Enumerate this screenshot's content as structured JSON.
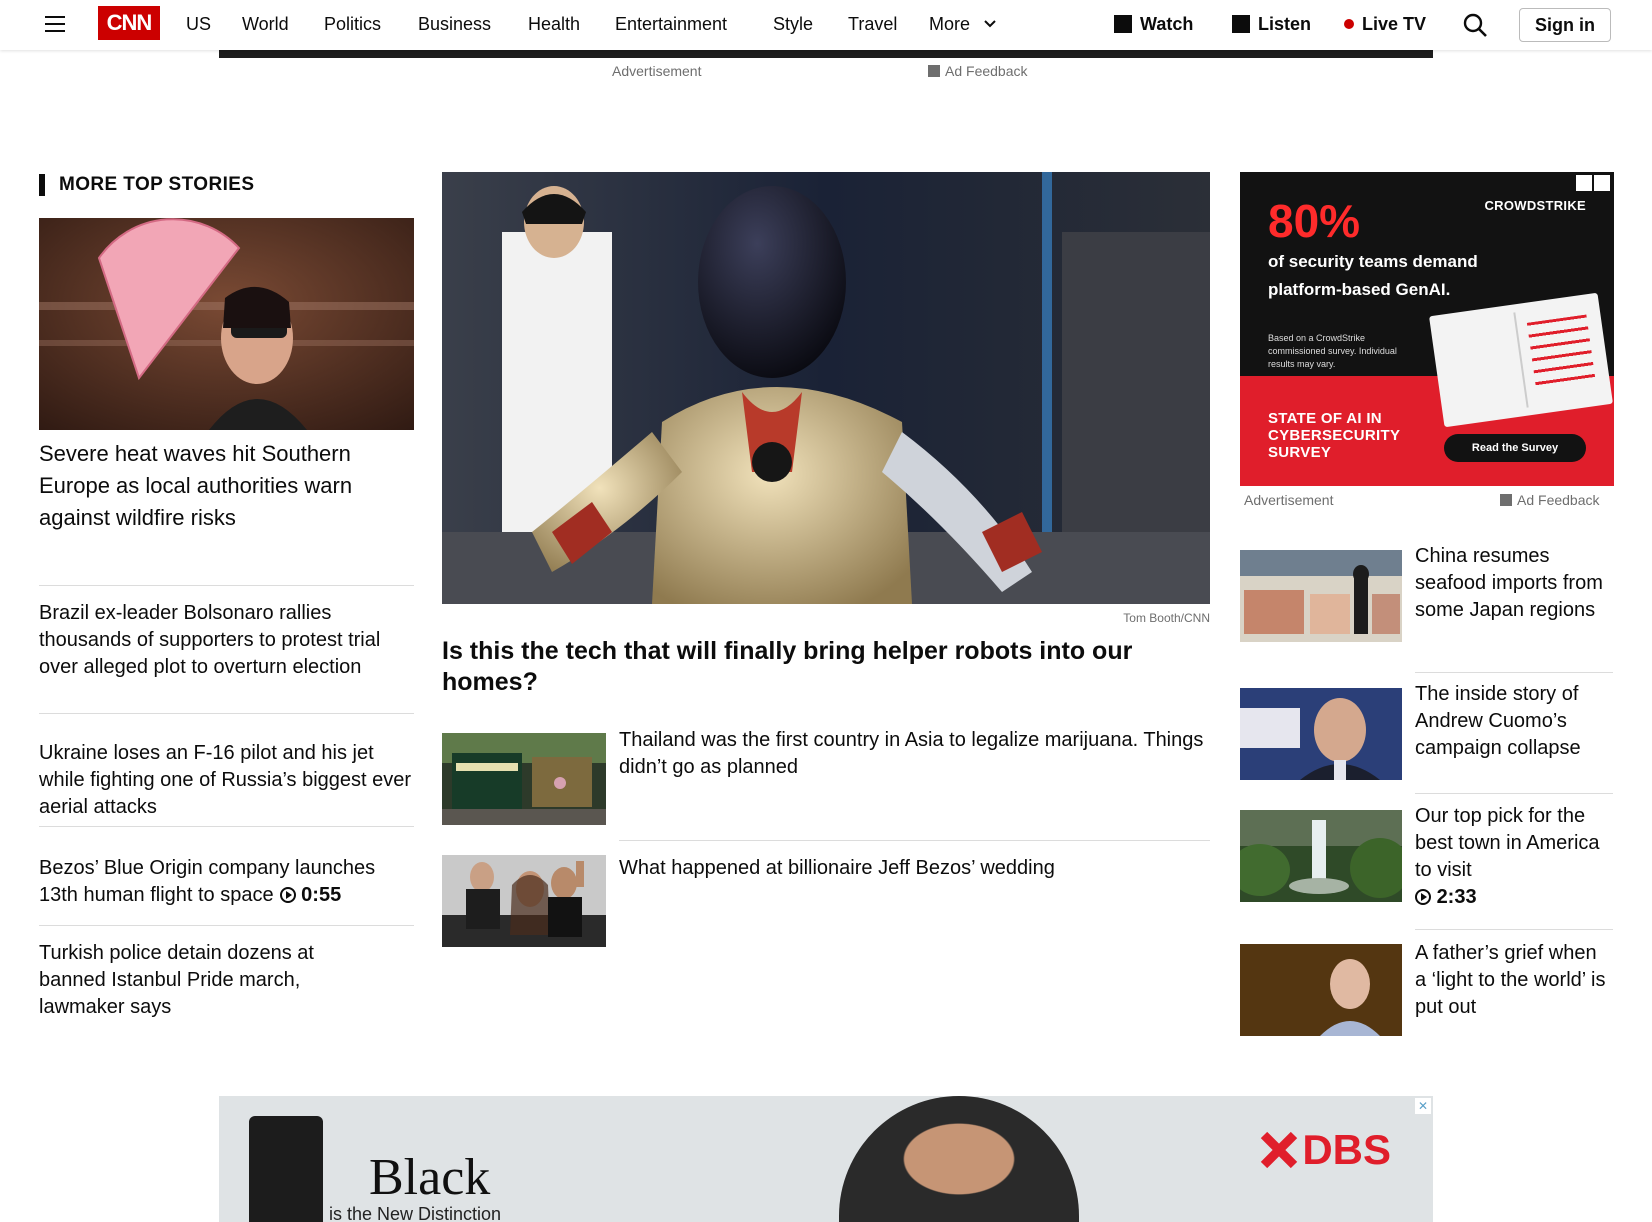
{
  "header": {
    "logo": "CNN",
    "nav": [
      "US",
      "World",
      "Politics",
      "Business",
      "Health",
      "Entertainment",
      "Style",
      "Travel",
      "More"
    ],
    "watch": "Watch",
    "listen": "Listen",
    "live_tv": "Live TV",
    "sign_in": "Sign in"
  },
  "top_ad": {
    "label": "Advertisement",
    "feedback": "Ad Feedback"
  },
  "section": {
    "title": "MORE TOP STORIES"
  },
  "left_stories": [
    {
      "headline": "Severe heat waves hit Southern Europe as local authorities warn against wildfire risks"
    },
    {
      "headline": "Brazil ex-leader Bolsonaro rallies thousands of supporters to protest trial over alleged plot to overturn election"
    },
    {
      "headline": "Ukraine loses an F-16 pilot and his jet while fighting one of Russia’s biggest ever aerial attacks"
    },
    {
      "headline": "Bezos’ Blue Origin company launches 13th human flight to space",
      "duration": "0:55"
    },
    {
      "headline": "Turkish police detain dozens at banned Istanbul Pride march, lawmaker says"
    }
  ],
  "lead": {
    "credit": "Tom Booth/CNN",
    "headline": "Is this the tech that will finally bring helper robots into our homes?"
  },
  "center_stories": [
    {
      "headline": "Thailand was the first country in Asia to legalize marijuana. Things didn’t go as planned"
    },
    {
      "headline": "What happened at billionaire Jeff Bezos’ wedding"
    }
  ],
  "right_ad": {
    "percent": "80%",
    "brand": "CROWDSTRIKE",
    "message": "of security teams demand platform-based GenAI.",
    "footnote": "Based on a CrowdStrike commissioned survey. Individual results may vary.",
    "survey": "STATE OF AI IN CYBERSECURITY SURVEY",
    "cta": "Read the Survey",
    "label": "Advertisement",
    "feedback": "Ad Feedback"
  },
  "right_stories": [
    {
      "headline": "China resumes seafood imports from some Japan regions"
    },
    {
      "headline": "The inside story of Andrew Cuomo’s campaign collapse"
    },
    {
      "headline": "Our top pick for the best town in America to visit",
      "duration": "2:33"
    },
    {
      "headline": "A father’s grief when a ‘light to the world’ is put out"
    }
  ],
  "bottom_ad": {
    "word": "Black",
    "tagline": "is the New Distinction",
    "brand": "DBS"
  },
  "colors": {
    "brand_red": "#cc0000",
    "ad_red": "#e01e2b",
    "text": "#0c0c0c",
    "muted": "#6e6e6e"
  }
}
